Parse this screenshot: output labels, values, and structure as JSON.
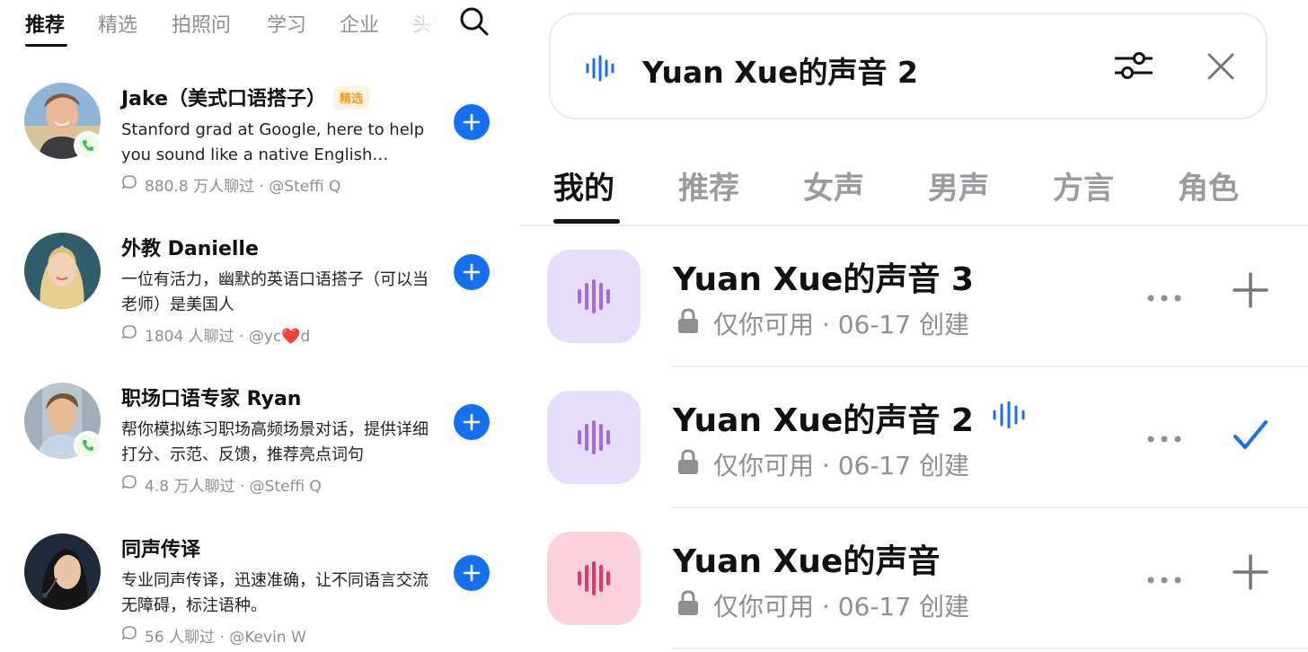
{
  "left_panel": {
    "tabs": [
      {
        "label": "推荐",
        "active": true
      },
      {
        "label": "精选",
        "active": false
      },
      {
        "label": "拍照问",
        "active": false
      },
      {
        "label": "学习",
        "active": false
      },
      {
        "label": "企业",
        "active": false
      },
      {
        "label": "头像",
        "active": false
      }
    ],
    "search_icon": "search-icon",
    "bots": [
      {
        "name": "Jake（美式口语搭子）",
        "badge": "精选",
        "description": "Stanford grad at Google, here to help you sound like a native English speaker",
        "chat_count": "880.8 万人聊过 · @Steffi Q",
        "has_phone": true,
        "avatar": "young-man-beach"
      },
      {
        "name": "外教 Danielle",
        "badge": "",
        "description": "一位有活力，幽默的英语口语搭子（可以当老师）是美国人",
        "chat_count": "1804 人聊过 · @yc❤️d",
        "has_phone": false,
        "avatar": "blonde-woman"
      },
      {
        "name": "职场口语专家 Ryan",
        "badge": "",
        "description": "帮你模拟练习职场高频场景对话，提供详细打分、示范、反馈，推荐亮点词句",
        "chat_count": "4.8 万人聊过 · @Steffi Q",
        "has_phone": true,
        "avatar": "man-office"
      },
      {
        "name": "同声传译",
        "badge": "",
        "description": "专业同声传译，迅速准确，让不同语言交流无障碍，标注语种。",
        "chat_count": "56 人聊过 · @Kevin W",
        "has_phone": false,
        "avatar": "woman-headset"
      }
    ],
    "colors": {
      "accent": "#1570ef",
      "badge_text": "#f59a23",
      "badge_bg": "#fff1dd",
      "phone_green": "#3ac24b"
    }
  },
  "right_panel": {
    "current_voice": {
      "name": "Yuan Xue的声音 2",
      "wave_icon": "voice-wave-icon",
      "settings_icon": "sliders-icon",
      "close_icon": "close-icon"
    },
    "tabs": [
      {
        "label": "我的",
        "active": true
      },
      {
        "label": "推荐",
        "active": false
      },
      {
        "label": "女声",
        "active": false
      },
      {
        "label": "男声",
        "active": false
      },
      {
        "label": "方言",
        "active": false
      },
      {
        "label": "角色",
        "active": false
      }
    ],
    "voices": [
      {
        "name": "Yuan Xue的声音 3",
        "meta": "仅你可用 · 06-17 创建",
        "tile_color": "#e6dcfb",
        "wave_color": "#a56ad6",
        "selected": false,
        "playing": false,
        "action": "plus-icon"
      },
      {
        "name": "Yuan Xue的声音 2",
        "meta": "仅你可用 · 06-17 创建",
        "tile_color": "#e6dcfb",
        "wave_color": "#a56ad6",
        "selected": true,
        "playing": true,
        "action": "checkmark-icon"
      },
      {
        "name": "Yuan Xue的声音",
        "meta": "仅你可用 · 06-17 创建",
        "tile_color": "#fbd2dc",
        "wave_color": "#e23a62",
        "selected": false,
        "playing": false,
        "action": "plus-icon"
      }
    ],
    "colors": {
      "accent": "#1570ef",
      "muted": "#8e8e93"
    }
  }
}
